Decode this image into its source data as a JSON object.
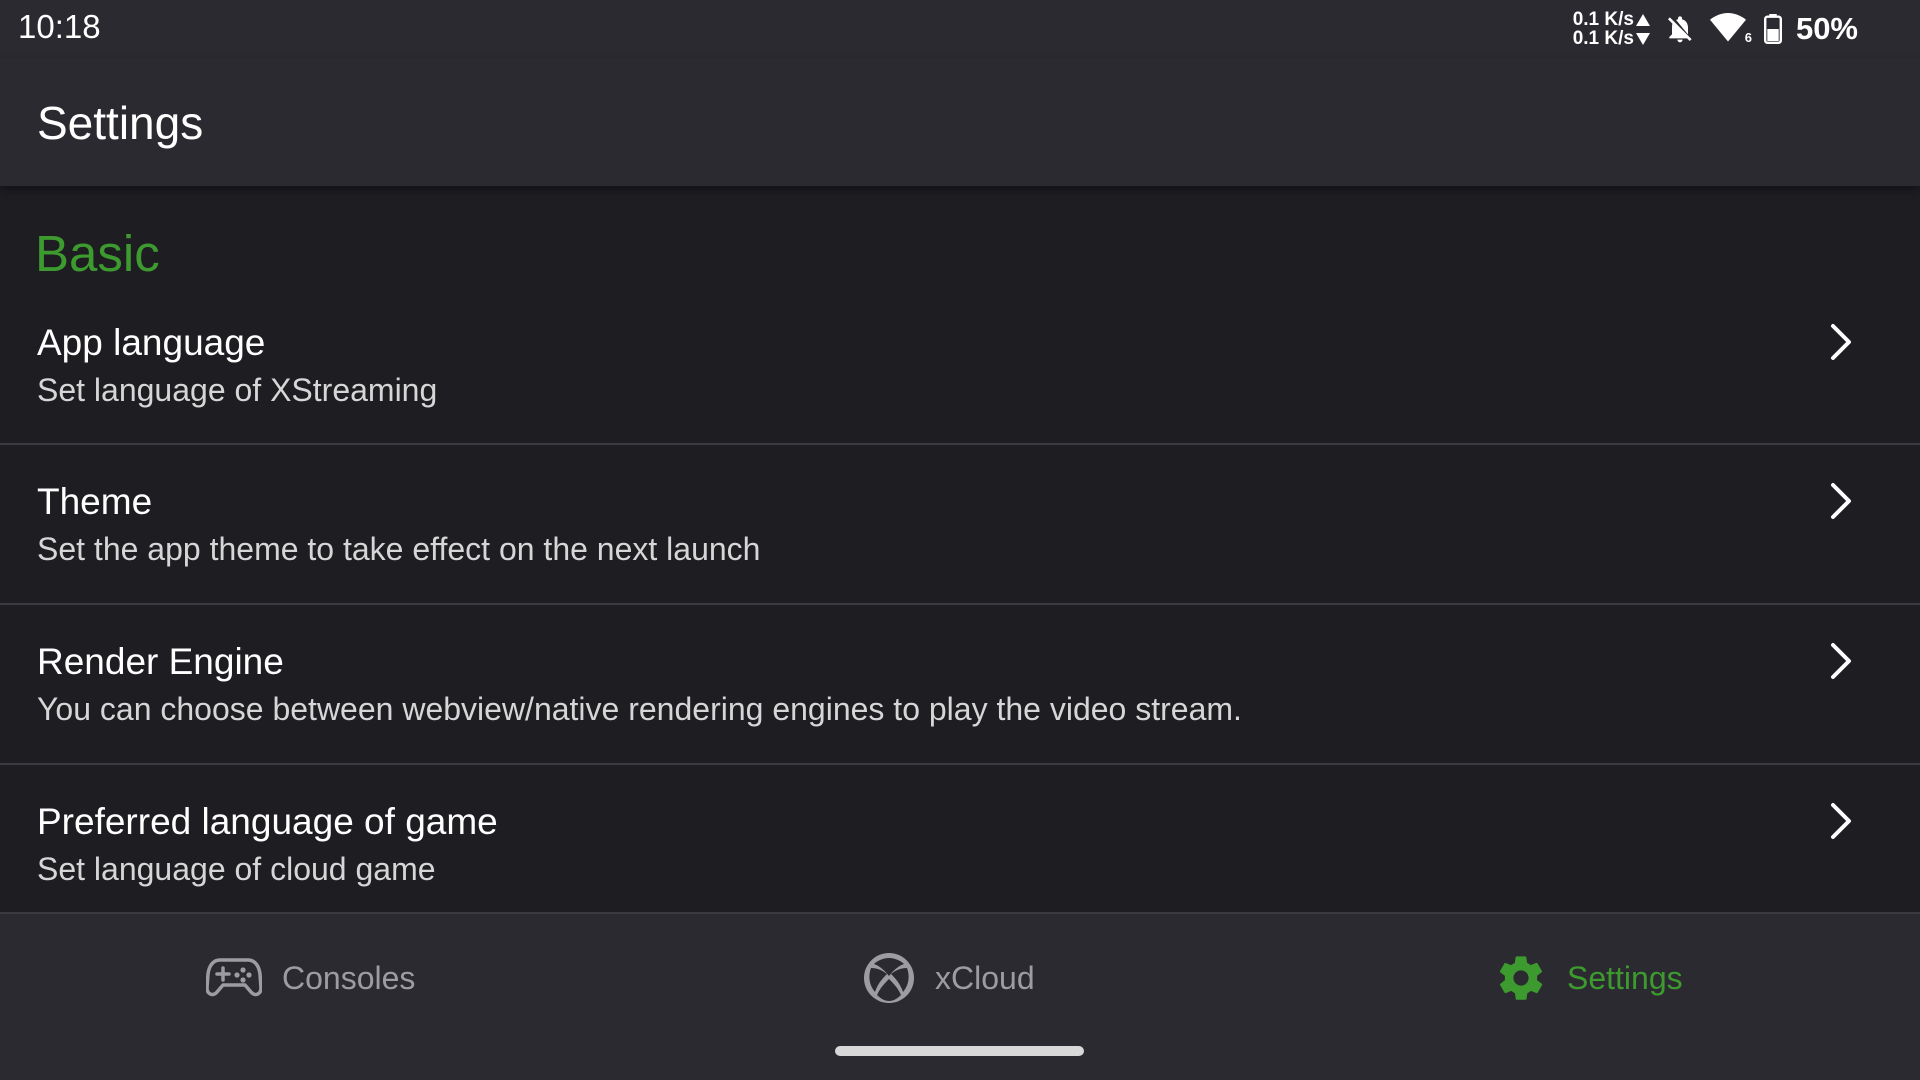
{
  "status_bar": {
    "time": "10:18",
    "upload_speed": "0.1 K/s",
    "download_speed": "0.1 K/s",
    "wifi_badge": "6",
    "battery_percent": "50%",
    "icons": [
      "up-arrow-icon",
      "down-arrow-icon",
      "bell-off-icon",
      "wifi-icon",
      "battery-icon"
    ]
  },
  "app_bar": {
    "title": "Settings"
  },
  "section": {
    "title": "Basic",
    "accent_color": "#3d9a2e"
  },
  "settings_items": [
    {
      "title": "App language",
      "subtitle": "Set language of XStreaming"
    },
    {
      "title": "Theme",
      "subtitle": "Set the app theme to take effect on the next launch"
    },
    {
      "title": "Render Engine",
      "subtitle": "You can choose between webview/native rendering engines to play the video stream."
    },
    {
      "title": "Preferred language of game",
      "subtitle": "Set language of cloud game"
    }
  ],
  "bottom_nav": {
    "items": [
      {
        "label": "Consoles",
        "icon": "gamepad-icon",
        "active": false
      },
      {
        "label": "xCloud",
        "icon": "xbox-logo-icon",
        "active": false
      },
      {
        "label": "Settings",
        "icon": "gear-icon",
        "active": true
      }
    ]
  },
  "colors": {
    "background": "#1d1d22",
    "bar_background": "#2b2a31",
    "accent": "#3d9a2e",
    "inactive": "#9c9ca2"
  }
}
